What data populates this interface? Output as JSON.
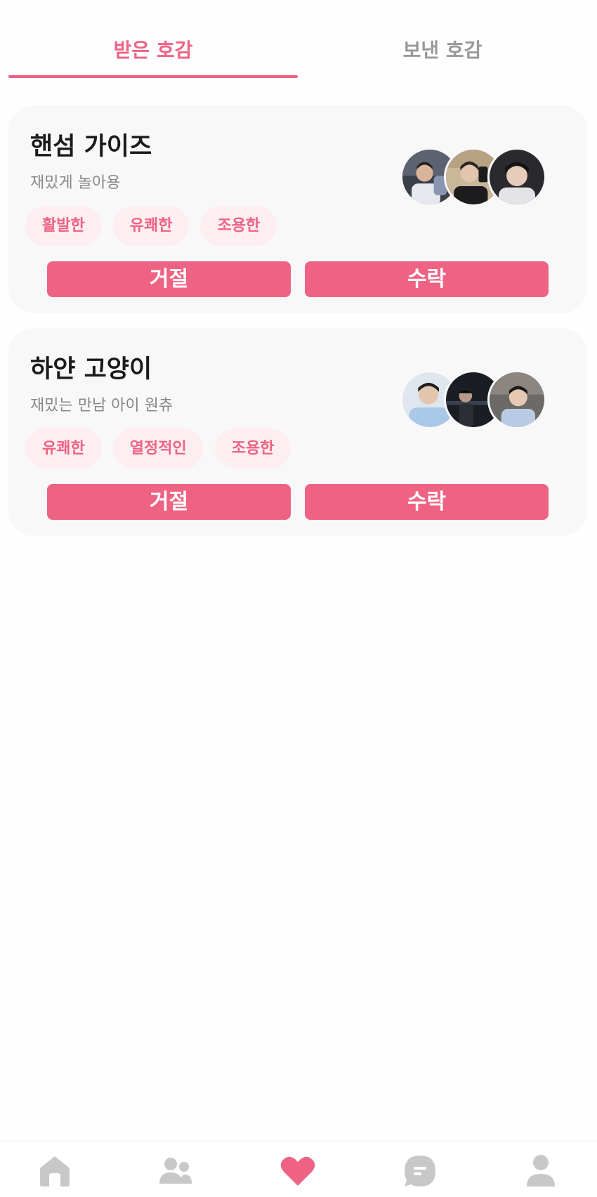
{
  "tabs": {
    "received": "받은 호감",
    "sent": "보낸 호감"
  },
  "cards": [
    {
      "title": "핸섬 가이즈",
      "description": "재밌게 놀아용",
      "tags": [
        "활발한",
        "유쾌한",
        "조용한"
      ],
      "reject_label": "거절",
      "accept_label": "수락"
    },
    {
      "title": "하얀 고양이",
      "description": "재밌는 만남 아이 원츄",
      "tags": [
        "유쾌한",
        "열정적인",
        "조용한"
      ],
      "reject_label": "거절",
      "accept_label": "수락"
    }
  ],
  "bottom_nav": {
    "items": [
      {
        "icon": "home-icon",
        "active": false
      },
      {
        "icon": "friends-icon",
        "active": false
      },
      {
        "icon": "heart-icon",
        "active": true
      },
      {
        "icon": "chat-icon",
        "active": false
      },
      {
        "icon": "profile-icon",
        "active": false
      }
    ]
  },
  "colors": {
    "accent": "#ee6383",
    "tag_bg": "#fdeef1",
    "card_bg": "#f8f8f9",
    "inactive": "#c8c8c8",
    "muted_text": "#999999"
  }
}
